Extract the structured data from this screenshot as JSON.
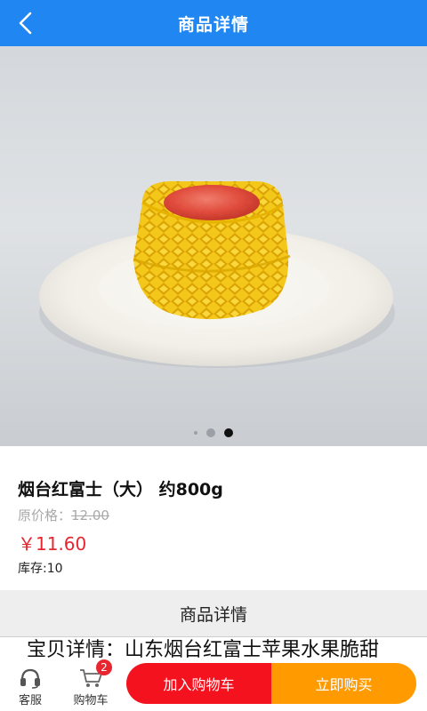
{
  "header": {
    "back_icon": "chevron-left-icon",
    "title": "商品详情",
    "color": "#1f86f2"
  },
  "carousel": {
    "total_slides": 2,
    "active_slide": 2
  },
  "product": {
    "name": "烟台红富士（大） 约800g",
    "original_price_label": "原价格：",
    "original_price": "12.00",
    "price": "￥11.60",
    "stock": "库存:10"
  },
  "detail": {
    "heading": "商品详情",
    "text": "宝贝详情：山东烟台红富士苹果水果脆甜"
  },
  "bottom_bar": {
    "service_label": "客服",
    "service_icon": "headset-icon",
    "cart_label": "购物车",
    "cart_icon": "cart-icon",
    "cart_count": "2",
    "add_to_cart": "加入购物车",
    "buy_now": "立即购买",
    "cart_button_color": "#f4121e",
    "buy_button_color": "#ff9b00"
  }
}
